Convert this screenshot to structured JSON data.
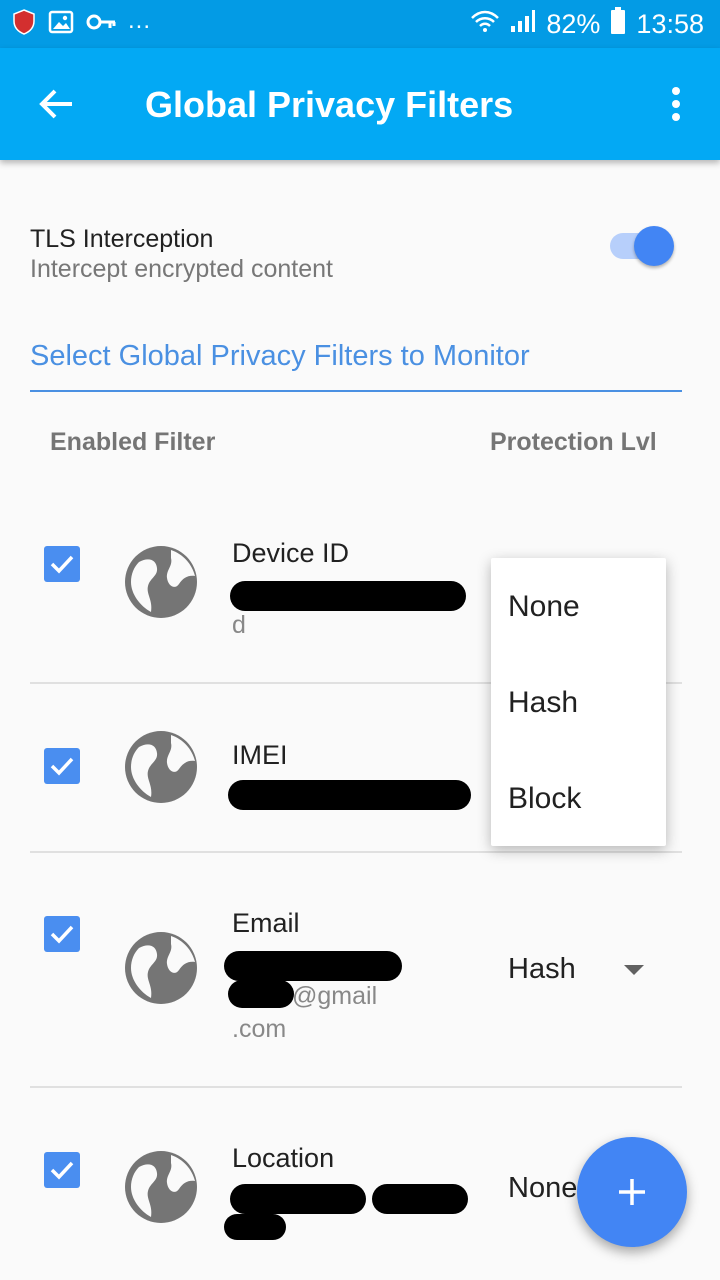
{
  "status_bar": {
    "ellipsis": "...",
    "battery": "82%",
    "time": "13:58",
    "icons": [
      "shield-icon",
      "image-icon",
      "key-icon",
      "wifi-icon",
      "signal-icon",
      "battery-icon"
    ]
  },
  "app_bar": {
    "title": "Global Privacy Filters",
    "back_icon": "back-arrow-icon",
    "menu_icon": "more-vert-icon"
  },
  "tls": {
    "title": "TLS Interception",
    "subtitle": "Intercept encrypted content",
    "enabled": true
  },
  "section": {
    "header": "Select Global Privacy Filters to Monitor",
    "col_enabled": "Enabled Filter",
    "col_protection": "Protection Lvl"
  },
  "filters": [
    {
      "name": "Device ID",
      "value_tail": "d",
      "protection": "",
      "checked": true
    },
    {
      "name": "IMEI",
      "protection": "",
      "checked": true
    },
    {
      "name": "Email",
      "value_mid": "@gmail",
      "value_tail": ".com",
      "protection": "Hash",
      "checked": true
    },
    {
      "name": "Location",
      "protection": "None",
      "checked": true
    }
  ],
  "dropdown_menu": {
    "options": [
      "None",
      "Hash",
      "Block"
    ]
  },
  "fab": {
    "label": "+",
    "icon": "add-icon"
  },
  "colors": {
    "status_bar": "#039be5",
    "app_bar": "#03a9f4",
    "accent": "#4285f4",
    "section_header": "#4a90e2"
  }
}
